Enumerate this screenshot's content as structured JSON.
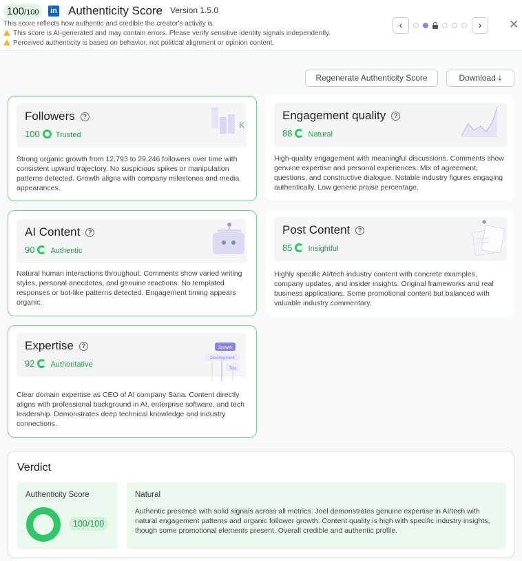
{
  "header": {
    "score_main": "100",
    "score_denom": "/100",
    "logo_text": "in",
    "title": "Authenticity Score",
    "version": "Version 1.5.0",
    "description": "This score reflects how authentic and credible the creator's activity is.",
    "warning1": "This score is AI-generated and may contain errors. Please verify sensitive identity signals independently.",
    "warning2": "Perceived authenticity is based on behavior, not political alignment or opinion content.",
    "prev": "‹",
    "next": "›",
    "close": "✕"
  },
  "toolbar": {
    "regenerate": "Regenerate Authenticity Score",
    "download": "Download",
    "download_icon": "⤓"
  },
  "cards": {
    "followers": {
      "title": "Followers",
      "score": "100",
      "label": "Trusted",
      "illus_text": "K",
      "body": "Strong organic growth from 12,793 to 29,246 followers over time with consistent upward trajectory. No suspicious spikes or manipulation patterns detected. Growth aligns with company milestones and media appearances."
    },
    "engagement": {
      "title": "Engagement quality",
      "score": "88",
      "label": "Natural",
      "body": "High-quality engagement with meaningful discussions. Comments show genuine expertise and personal experiences. Mix of agreement, questions, and constructive dialogue. Notable industry figures engaging authentically. Low generic praise percentage."
    },
    "ai": {
      "title": "AI Content",
      "score": "90",
      "label": "Authentic",
      "body": "Natural human interactions throughout. Comments show varied writing styles, personal anecdotes, and genuine reactions. No templated responses or bot-like patterns detected. Engagement timing appears organic."
    },
    "post": {
      "title": "Post Content",
      "score": "85",
      "label": "Insightful",
      "body": "Highly specific AI/tech industry content with concrete examples, company updates, and insider insights. Original frameworks and real business applications. Some promotional content but balanced with valuable industry commentary."
    },
    "expertise": {
      "title": "Expertise",
      "score": "92",
      "label": "Authoritative",
      "tags": [
        "Growth",
        "Development",
        "Tips"
      ],
      "body": "Clear domain expertise as CEO of AI company Sana. Content directly aligns with professional background in AI, enterprise software, and tech leadership. Demonstrates deep technical knowledge and industry connections."
    }
  },
  "verdict": {
    "title": "Verdict",
    "score_label": "Authenticity Score",
    "score_value": "100/100",
    "score_fraction": 1.0,
    "type": "Natural",
    "text": "Authentic presence with solid signals across all metrics. Joel demonstrates genuine expertise in AI/tech with natural engagement patterns and organic follower growth. Content quality is high with specific industry insights, though some promotional elements present. Overall credible and authentic profile."
  },
  "colors": {
    "accent": "#2ec866",
    "brand": "#0a66c2",
    "purple": "#8b82e0"
  }
}
